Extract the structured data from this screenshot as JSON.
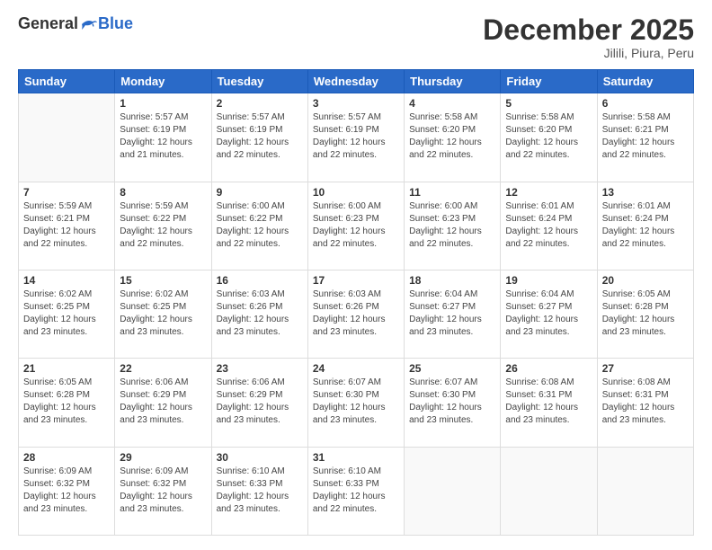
{
  "logo": {
    "general": "General",
    "blue": "Blue"
  },
  "header": {
    "title": "December 2025",
    "location": "Jilili, Piura, Peru"
  },
  "days_of_week": [
    "Sunday",
    "Monday",
    "Tuesday",
    "Wednesday",
    "Thursday",
    "Friday",
    "Saturday"
  ],
  "weeks": [
    [
      {
        "day": "",
        "info": ""
      },
      {
        "day": "1",
        "info": "Sunrise: 5:57 AM\nSunset: 6:19 PM\nDaylight: 12 hours\nand 21 minutes."
      },
      {
        "day": "2",
        "info": "Sunrise: 5:57 AM\nSunset: 6:19 PM\nDaylight: 12 hours\nand 22 minutes."
      },
      {
        "day": "3",
        "info": "Sunrise: 5:57 AM\nSunset: 6:19 PM\nDaylight: 12 hours\nand 22 minutes."
      },
      {
        "day": "4",
        "info": "Sunrise: 5:58 AM\nSunset: 6:20 PM\nDaylight: 12 hours\nand 22 minutes."
      },
      {
        "day": "5",
        "info": "Sunrise: 5:58 AM\nSunset: 6:20 PM\nDaylight: 12 hours\nand 22 minutes."
      },
      {
        "day": "6",
        "info": "Sunrise: 5:58 AM\nSunset: 6:21 PM\nDaylight: 12 hours\nand 22 minutes."
      }
    ],
    [
      {
        "day": "7",
        "info": "Sunrise: 5:59 AM\nSunset: 6:21 PM\nDaylight: 12 hours\nand 22 minutes."
      },
      {
        "day": "8",
        "info": "Sunrise: 5:59 AM\nSunset: 6:22 PM\nDaylight: 12 hours\nand 22 minutes."
      },
      {
        "day": "9",
        "info": "Sunrise: 6:00 AM\nSunset: 6:22 PM\nDaylight: 12 hours\nand 22 minutes."
      },
      {
        "day": "10",
        "info": "Sunrise: 6:00 AM\nSunset: 6:23 PM\nDaylight: 12 hours\nand 22 minutes."
      },
      {
        "day": "11",
        "info": "Sunrise: 6:00 AM\nSunset: 6:23 PM\nDaylight: 12 hours\nand 22 minutes."
      },
      {
        "day": "12",
        "info": "Sunrise: 6:01 AM\nSunset: 6:24 PM\nDaylight: 12 hours\nand 22 minutes."
      },
      {
        "day": "13",
        "info": "Sunrise: 6:01 AM\nSunset: 6:24 PM\nDaylight: 12 hours\nand 22 minutes."
      }
    ],
    [
      {
        "day": "14",
        "info": "Sunrise: 6:02 AM\nSunset: 6:25 PM\nDaylight: 12 hours\nand 23 minutes."
      },
      {
        "day": "15",
        "info": "Sunrise: 6:02 AM\nSunset: 6:25 PM\nDaylight: 12 hours\nand 23 minutes."
      },
      {
        "day": "16",
        "info": "Sunrise: 6:03 AM\nSunset: 6:26 PM\nDaylight: 12 hours\nand 23 minutes."
      },
      {
        "day": "17",
        "info": "Sunrise: 6:03 AM\nSunset: 6:26 PM\nDaylight: 12 hours\nand 23 minutes."
      },
      {
        "day": "18",
        "info": "Sunrise: 6:04 AM\nSunset: 6:27 PM\nDaylight: 12 hours\nand 23 minutes."
      },
      {
        "day": "19",
        "info": "Sunrise: 6:04 AM\nSunset: 6:27 PM\nDaylight: 12 hours\nand 23 minutes."
      },
      {
        "day": "20",
        "info": "Sunrise: 6:05 AM\nSunset: 6:28 PM\nDaylight: 12 hours\nand 23 minutes."
      }
    ],
    [
      {
        "day": "21",
        "info": "Sunrise: 6:05 AM\nSunset: 6:28 PM\nDaylight: 12 hours\nand 23 minutes."
      },
      {
        "day": "22",
        "info": "Sunrise: 6:06 AM\nSunset: 6:29 PM\nDaylight: 12 hours\nand 23 minutes."
      },
      {
        "day": "23",
        "info": "Sunrise: 6:06 AM\nSunset: 6:29 PM\nDaylight: 12 hours\nand 23 minutes."
      },
      {
        "day": "24",
        "info": "Sunrise: 6:07 AM\nSunset: 6:30 PM\nDaylight: 12 hours\nand 23 minutes."
      },
      {
        "day": "25",
        "info": "Sunrise: 6:07 AM\nSunset: 6:30 PM\nDaylight: 12 hours\nand 23 minutes."
      },
      {
        "day": "26",
        "info": "Sunrise: 6:08 AM\nSunset: 6:31 PM\nDaylight: 12 hours\nand 23 minutes."
      },
      {
        "day": "27",
        "info": "Sunrise: 6:08 AM\nSunset: 6:31 PM\nDaylight: 12 hours\nand 23 minutes."
      }
    ],
    [
      {
        "day": "28",
        "info": "Sunrise: 6:09 AM\nSunset: 6:32 PM\nDaylight: 12 hours\nand 23 minutes."
      },
      {
        "day": "29",
        "info": "Sunrise: 6:09 AM\nSunset: 6:32 PM\nDaylight: 12 hours\nand 23 minutes."
      },
      {
        "day": "30",
        "info": "Sunrise: 6:10 AM\nSunset: 6:33 PM\nDaylight: 12 hours\nand 23 minutes."
      },
      {
        "day": "31",
        "info": "Sunrise: 6:10 AM\nSunset: 6:33 PM\nDaylight: 12 hours\nand 22 minutes."
      },
      {
        "day": "",
        "info": ""
      },
      {
        "day": "",
        "info": ""
      },
      {
        "day": "",
        "info": ""
      }
    ]
  ]
}
